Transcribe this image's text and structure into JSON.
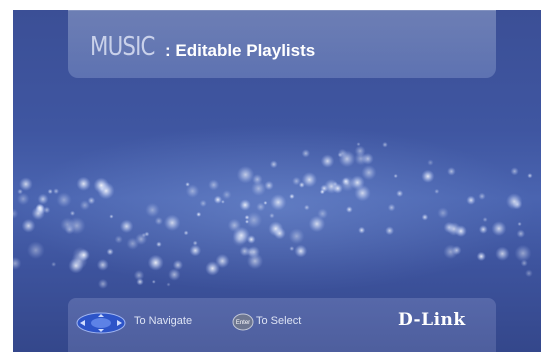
{
  "header": {
    "section": "MUSIC",
    "subtitle": ": Editable Playlists"
  },
  "footer": {
    "navigate_icon": "dpad-icon",
    "navigate_label": "To Navigate",
    "enter_icon": "enter-button-icon",
    "enter_text": "Enter",
    "select_label": "To Select",
    "logo": "D-Link"
  },
  "colors": {
    "background": "#3f56a1",
    "panel": "#8a9ad0",
    "text": "#ffffff"
  }
}
